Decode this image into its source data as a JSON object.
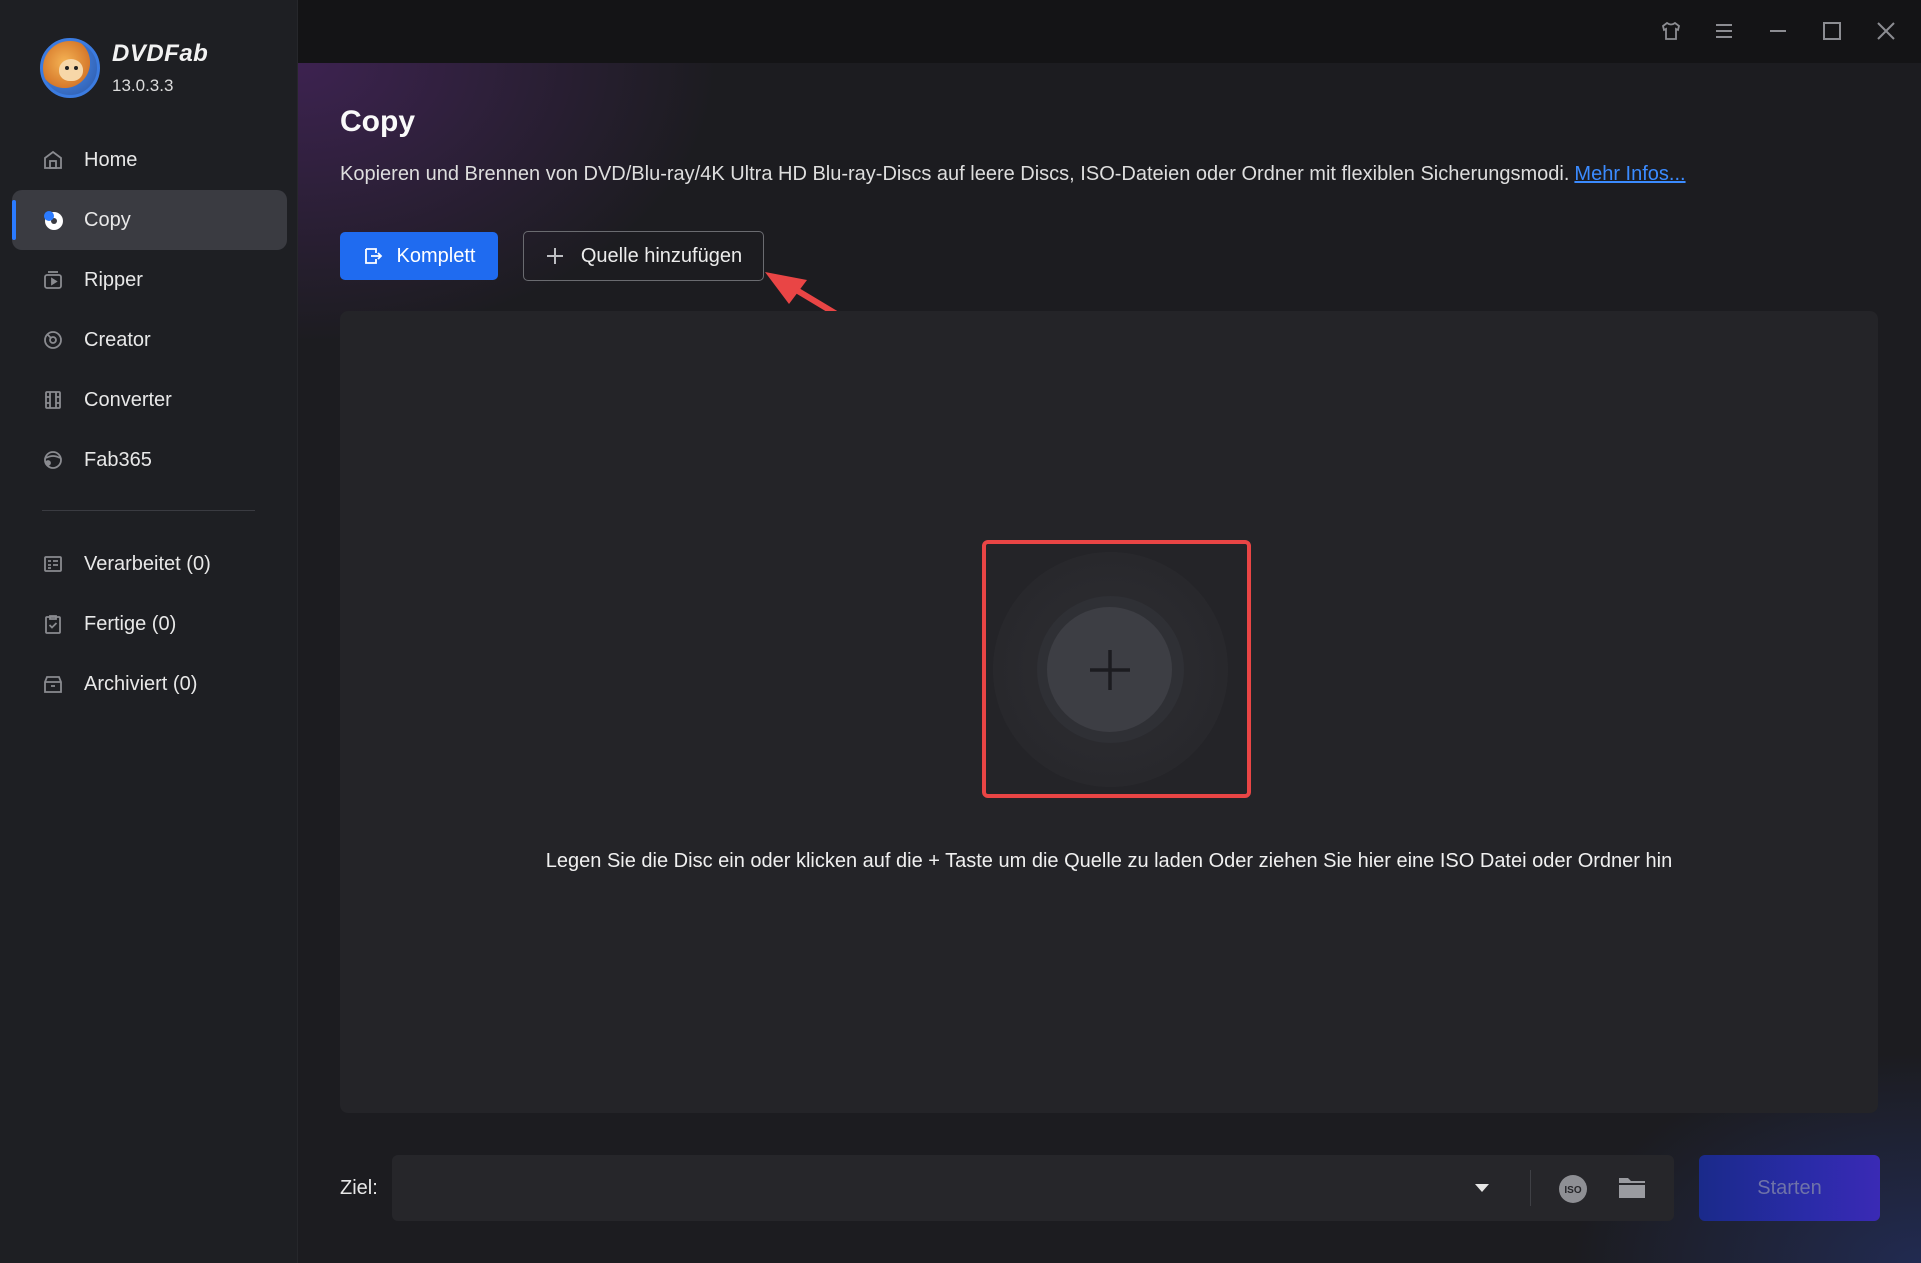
{
  "app": {
    "name": "DVDFab",
    "version": "13.0.3.3"
  },
  "sidebar": {
    "main_items": [
      {
        "label": "Home",
        "icon": "home-icon"
      },
      {
        "label": "Copy",
        "icon": "disc-copy-icon",
        "active": true
      },
      {
        "label": "Ripper",
        "icon": "ripper-icon"
      },
      {
        "label": "Creator",
        "icon": "creator-icon"
      },
      {
        "label": "Converter",
        "icon": "film-icon"
      },
      {
        "label": "Fab365",
        "icon": "fab365-icon"
      }
    ],
    "queue_items": [
      {
        "label": "Verarbeitet (0)",
        "icon": "list-icon"
      },
      {
        "label": "Fertige (0)",
        "icon": "clipboard-check-icon"
      },
      {
        "label": "Archiviert (0)",
        "icon": "archive-icon"
      }
    ]
  },
  "titlebar": {
    "icons": [
      "shirt-skin-icon",
      "menu-icon",
      "minimize-icon",
      "maximize-icon",
      "close-icon"
    ]
  },
  "main": {
    "title": "Copy",
    "description": "Kopieren und Brennen von DVD/Blu-ray/4K Ultra HD Blu-ray-Discs auf leere Discs, ISO-Dateien oder Ordner mit flexiblen Sicherungsmodi.",
    "more_info_link": "Mehr Infos...",
    "mode_button": "Komplett",
    "add_source_button": "Quelle hinzufügen",
    "drop_hint": "Legen Sie die Disc ein oder klicken auf die + Taste um die Quelle zu laden Oder ziehen Sie hier eine ISO Datei oder Ordner hin"
  },
  "bottom": {
    "ziel_label": "Ziel:",
    "ziel_value": "",
    "start_button": "Starten",
    "iso_label": "ISO"
  },
  "colors": {
    "accent": "#1f6bf0",
    "annotation": "#e94545",
    "link": "#3b8bff"
  }
}
